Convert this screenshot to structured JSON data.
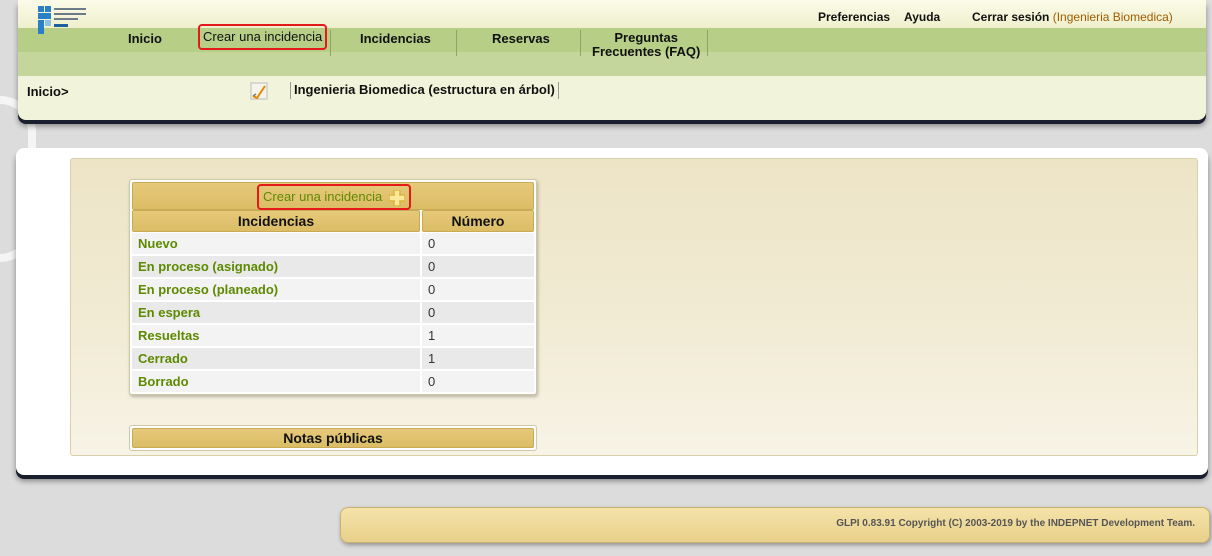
{
  "header": {
    "logo_icon": "ministry-logo-icon",
    "top_links": {
      "preferences": "Preferencias",
      "help": "Ayuda",
      "logout": "Cerrar sesión",
      "user": "(Ingenieria Biomedica)"
    },
    "menu": {
      "home": "Inicio",
      "create_ticket": "Crear una incidencia",
      "tickets": "Incidencias",
      "reservations": "Reservas",
      "faq_line1": "Preguntas",
      "faq_line2": "Frecuentes (FAQ)"
    },
    "breadcrumb": "Inicio>",
    "entity_tree": "Ingenieria Biomedica (estructura en árbol)"
  },
  "tickets_panel": {
    "create_link": "Crear una incidencia",
    "col_tickets": "Incidencias",
    "col_number": "Número",
    "rows": [
      {
        "label": "Nuevo",
        "count": "0"
      },
      {
        "label": "En proceso (asignado)",
        "count": "0"
      },
      {
        "label": "En proceso (planeado)",
        "count": "0"
      },
      {
        "label": "En espera",
        "count": "0"
      },
      {
        "label": "Resueltas",
        "count": "1"
      },
      {
        "label": "Cerrado",
        "count": "1"
      },
      {
        "label": "Borrado",
        "count": "0"
      }
    ]
  },
  "public_notes": {
    "title": "Notas públicas"
  },
  "footer": {
    "text": "GLPI 0.83.91 Copyright (C) 2003-2019 by the INDEPNET Development Team."
  },
  "colors": {
    "menu_bar": "#b7ce86",
    "link_green": "#5d8a00",
    "highlight_red": "#e41a1a",
    "table_header": "#dbbd66"
  }
}
